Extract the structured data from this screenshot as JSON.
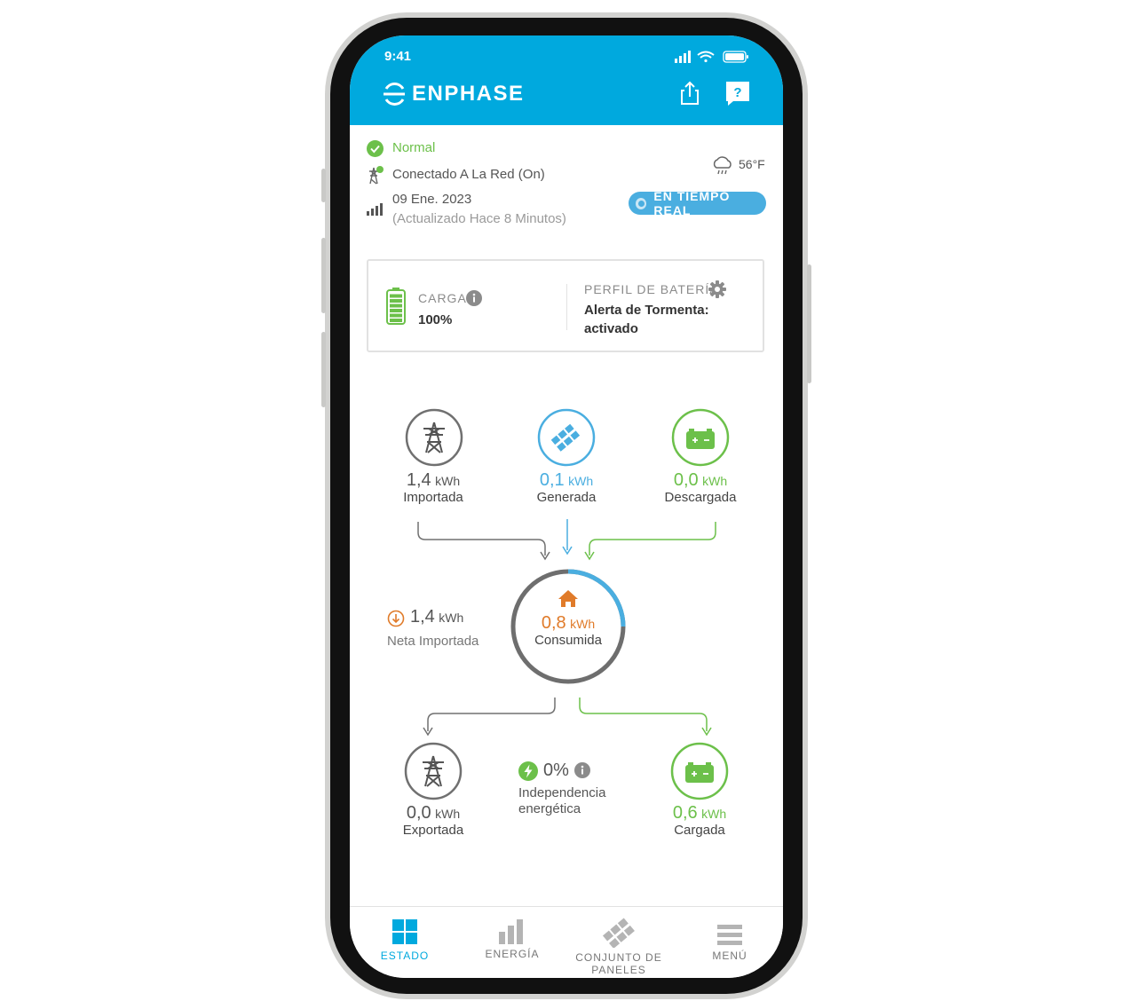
{
  "status_bar": {
    "time": "9:41"
  },
  "brand": {
    "name": "ENPHASE"
  },
  "system": {
    "status": "Normal",
    "grid": "Conectado A La Red (On)",
    "date": "09 Ene. 2023",
    "updated": "(Actualizado Hace 8 Minutos)",
    "temperature": "56°F",
    "realtime_label": "EN TIEMPO REAL"
  },
  "battery_card": {
    "charge_label": "CARGA",
    "charge_value": "100%",
    "charge_level": 1.0,
    "profile_label": "PERFIL DE BATERÍA",
    "profile_line1": "Alerta de Tormenta:",
    "profile_line2": "activado"
  },
  "flow": {
    "imported": {
      "value": "1,4",
      "unit": "kWh",
      "label": "Importada"
    },
    "generated": {
      "value": "0,1",
      "unit": "kWh",
      "label": "Generada"
    },
    "discharged": {
      "value": "0,0",
      "unit": "kWh",
      "label": "Descargada"
    },
    "net_imported": {
      "value": "1,4",
      "unit": "kWh",
      "label": "Neta Importada"
    },
    "consumed": {
      "value": "0,8",
      "unit": "kWh",
      "label": "Consumida",
      "solar_share": 0.25
    },
    "exported": {
      "value": "0,0",
      "unit": "kWh",
      "label": "Exportada"
    },
    "independence": {
      "value": "0%",
      "line1": "Independencia",
      "line2": "energética"
    },
    "charged": {
      "value": "0,6",
      "unit": "kWh",
      "label": "Cargada"
    }
  },
  "tabs": [
    {
      "label": "ESTADO",
      "active": true
    },
    {
      "label": "ENERGÍA",
      "active": false
    },
    {
      "label": "CONJUNTO DE PANELES",
      "active": false
    },
    {
      "label": "MENÚ",
      "active": false
    }
  ],
  "colors": {
    "header": "#00a9de",
    "green": "#6cc04a",
    "blue": "#4aaee0",
    "orange": "#e07b2a",
    "gray": "#707070"
  }
}
